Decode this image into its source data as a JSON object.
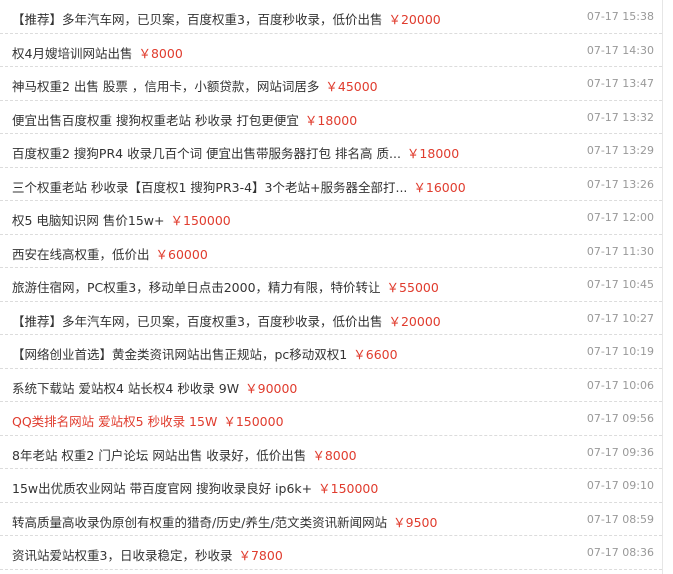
{
  "colors": {
    "price": "#e03c2e",
    "text": "#333333",
    "date": "#999999"
  },
  "items": [
    {
      "title": "【推荐】多年汽车网，已贝案，百度权重3，百度秒收录，低价出售",
      "price": "￥20000",
      "date": "07-17 15:38",
      "highlight": false
    },
    {
      "title": "权4月嫂培训网站出售",
      "price": "￥8000",
      "date": "07-17 14:30",
      "highlight": false
    },
    {
      "title": "神马权重2 出售 股票 ，信用卡，小额贷款，网站词居多",
      "price": "￥45000",
      "date": "07-17 13:47",
      "highlight": false
    },
    {
      "title": "便宜出售百度权重 搜狗权重老站 秒收录 打包更便宜",
      "price": "￥18000",
      "date": "07-17 13:32",
      "highlight": false
    },
    {
      "title": "百度权重2 搜狗PR4 收录几百个词 便宜出售带服务器打包 排名高 质...",
      "price": "￥18000",
      "date": "07-17 13:29",
      "highlight": false
    },
    {
      "title": "三个权重老站 秒收录【百度权1 搜狗PR3-4】3个老站+服务器全部打...",
      "price": "￥16000",
      "date": "07-17 13:26",
      "highlight": false
    },
    {
      "title": "权5 电脑知识网 售价15w+",
      "price": "￥150000",
      "date": "07-17 12:00",
      "highlight": false
    },
    {
      "title": "西安在线高权重，低价出",
      "price": "￥60000",
      "date": "07-17 11:30",
      "highlight": false
    },
    {
      "title": "旅游住宿网，PC权重3，移动单日点击2000，精力有限，特价转让",
      "price": "￥55000",
      "date": "07-17 10:45",
      "highlight": false
    },
    {
      "title": "【推荐】多年汽车网，已贝案，百度权重3，百度秒收录，低价出售",
      "price": "￥20000",
      "date": "07-17 10:27",
      "highlight": false
    },
    {
      "title": "【网络创业首选】黄金类资讯网站出售正规站，pc移动双权1",
      "price": "￥6600",
      "date": "07-17 10:19",
      "highlight": false
    },
    {
      "title": "系统下载站 爱站权4 站长权4 秒收录 9W",
      "price": "￥90000",
      "date": "07-17 10:06",
      "highlight": false
    },
    {
      "title": "QQ类排名网站 爱站权5 秒收录 15W",
      "price": "￥150000",
      "date": "07-17 09:56",
      "highlight": true
    },
    {
      "title": "8年老站 权重2 门户论坛 网站出售 收录好，低价出售",
      "price": "￥8000",
      "date": "07-17 09:36",
      "highlight": false
    },
    {
      "title": "15w出优质农业网站 带百度官网 搜狗收录良好 ip6k+",
      "price": "￥150000",
      "date": "07-17 09:10",
      "highlight": false
    },
    {
      "title": "转高质量高收录伪原创有权重的猎奇/历史/养生/范文类资讯新闻网站",
      "price": "￥9500",
      "date": "07-17 08:59",
      "highlight": false
    },
    {
      "title": "资讯站爱站权重3，日收录稳定，秒收录",
      "price": "￥7800",
      "date": "07-17 08:36",
      "highlight": false
    }
  ]
}
